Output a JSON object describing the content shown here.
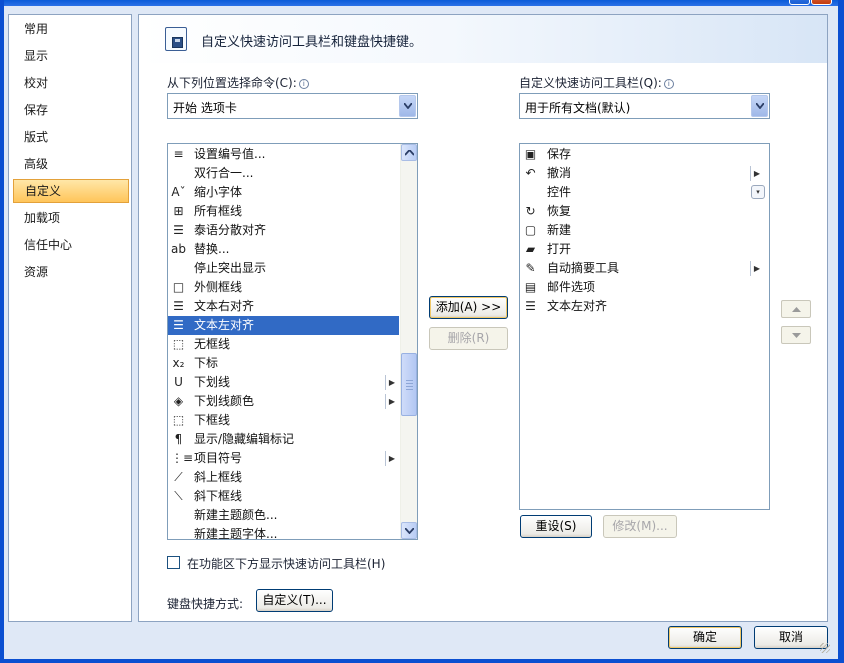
{
  "nav": {
    "items": [
      {
        "label": "常用",
        "active": false
      },
      {
        "label": "显示",
        "active": false
      },
      {
        "label": "校对",
        "active": false
      },
      {
        "label": "保存",
        "active": false
      },
      {
        "label": "版式",
        "active": false
      },
      {
        "label": "高级",
        "active": false
      },
      {
        "label": "自定义",
        "active": true
      },
      {
        "label": "加载项",
        "active": false
      },
      {
        "label": "信任中心",
        "active": false
      },
      {
        "label": "资源",
        "active": false
      }
    ]
  },
  "header": {
    "title": "自定义快速访问工具栏和键盘快捷键。"
  },
  "left": {
    "label": "从下列位置选择命令(C):",
    "combo_value": "开始 选项卡",
    "items": [
      {
        "icon": "numbering-value-icon",
        "glyph": "≡",
        "label": "设置编号值...",
        "submenu": false,
        "selected": false
      },
      {
        "icon": "",
        "glyph": "",
        "label": "双行合一...",
        "submenu": false,
        "selected": false
      },
      {
        "icon": "shrink-font-icon",
        "glyph": "Aˇ",
        "label": "缩小字体",
        "submenu": false,
        "selected": false
      },
      {
        "icon": "all-borders-icon",
        "glyph": "⊞",
        "label": "所有框线",
        "submenu": false,
        "selected": false
      },
      {
        "icon": "thai-distribute-icon",
        "glyph": "☰",
        "label": "泰语分散对齐",
        "submenu": false,
        "selected": false
      },
      {
        "icon": "replace-icon",
        "glyph": "ab",
        "label": "替换...",
        "submenu": false,
        "selected": false
      },
      {
        "icon": "",
        "glyph": "",
        "label": "停止突出显示",
        "submenu": false,
        "selected": false
      },
      {
        "icon": "outside-borders-icon",
        "glyph": "□",
        "label": "外侧框线",
        "submenu": false,
        "selected": false
      },
      {
        "icon": "align-right-icon",
        "glyph": "☰",
        "label": "文本右对齐",
        "submenu": false,
        "selected": false
      },
      {
        "icon": "align-left-icon",
        "glyph": "☰",
        "label": "文本左对齐",
        "submenu": false,
        "selected": true
      },
      {
        "icon": "no-border-icon",
        "glyph": "⬚",
        "label": "无框线",
        "submenu": false,
        "selected": false
      },
      {
        "icon": "subscript-icon",
        "glyph": "x₂",
        "label": "下标",
        "submenu": false,
        "selected": false
      },
      {
        "icon": "underline-icon",
        "glyph": "U",
        "label": "下划线",
        "submenu": true,
        "selected": false
      },
      {
        "icon": "underline-color-icon",
        "glyph": "◈",
        "label": "下划线颜色",
        "submenu": true,
        "selected": false
      },
      {
        "icon": "bottom-border-icon",
        "glyph": "⬚",
        "label": "下框线",
        "submenu": false,
        "selected": false
      },
      {
        "icon": "show-marks-icon",
        "glyph": "¶",
        "label": "显示/隐藏编辑标记",
        "submenu": false,
        "selected": false
      },
      {
        "icon": "bullets-icon",
        "glyph": "⋮≡",
        "label": "项目符号",
        "submenu": true,
        "selected": false
      },
      {
        "icon": "diagonal-up-border-icon",
        "glyph": "⟋",
        "label": "斜上框线",
        "submenu": false,
        "selected": false
      },
      {
        "icon": "diagonal-down-border-icon",
        "glyph": "⟍",
        "label": "斜下框线",
        "submenu": false,
        "selected": false
      },
      {
        "icon": "",
        "glyph": "",
        "label": "新建主题颜色...",
        "submenu": false,
        "selected": false
      },
      {
        "icon": "",
        "glyph": "",
        "label": "新建主题字体...",
        "submenu": false,
        "selected": false
      }
    ]
  },
  "middle": {
    "add_label": "添加(A) >>",
    "remove_label": "删除(R)"
  },
  "right": {
    "label": "自定义快速访问工具栏(Q):",
    "combo_value": "用于所有文档(默认)",
    "items": [
      {
        "icon": "save-icon",
        "glyph": "▣",
        "label": "保存",
        "mark": ""
      },
      {
        "icon": "undo-icon",
        "glyph": "↶",
        "label": "撤消",
        "mark": "submenu"
      },
      {
        "icon": "",
        "glyph": "",
        "label": "控件",
        "mark": "dropdown"
      },
      {
        "icon": "redo-icon",
        "glyph": "↻",
        "label": "恢复",
        "mark": ""
      },
      {
        "icon": "new-doc-icon",
        "glyph": "▢",
        "label": "新建",
        "mark": ""
      },
      {
        "icon": "open-folder-icon",
        "glyph": "▰",
        "label": "打开",
        "mark": ""
      },
      {
        "icon": "autosummarize-icon",
        "glyph": "✎",
        "label": "自动摘要工具",
        "mark": "submenu"
      },
      {
        "icon": "mail-options-icon",
        "glyph": "▤",
        "label": "邮件选项",
        "mark": ""
      },
      {
        "icon": "align-left-icon",
        "glyph": "☰",
        "label": "文本左对齐",
        "mark": ""
      }
    ],
    "reset_label": "重设(S)",
    "modify_label": "修改(M)..."
  },
  "options": {
    "show_below_ribbon_label": "在功能区下方显示快速访问工具栏(H)",
    "show_below_ribbon_checked": false,
    "keyboard_label": "键盘快捷方式:",
    "keyboard_button": "自定义(T)..."
  },
  "footer": {
    "ok_label": "确定",
    "cancel_label": "取消"
  }
}
